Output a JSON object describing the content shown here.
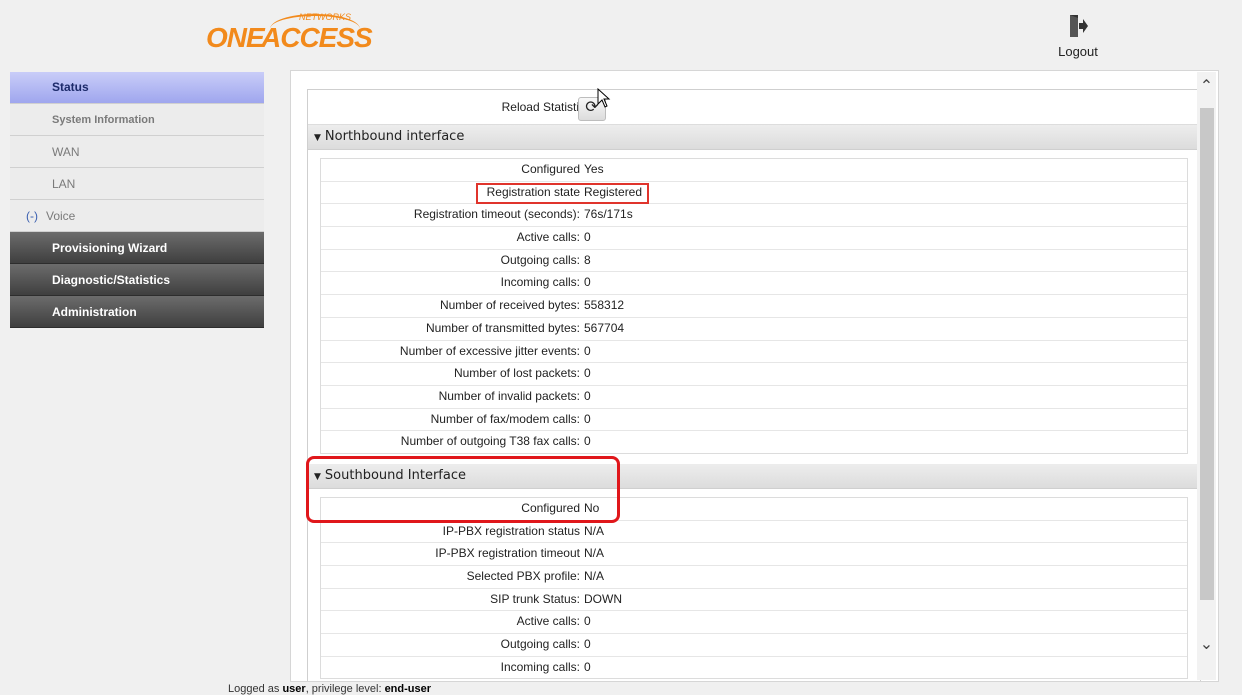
{
  "brand": {
    "one": "ONE",
    "access": "ACCESS",
    "networks": "NETWORKS"
  },
  "header": {
    "logout_label": "Logout",
    "logout_icon": "logout-door-icon"
  },
  "sidebar": {
    "items": [
      {
        "label": "Status"
      },
      {
        "label": "System Information"
      },
      {
        "label": "WAN"
      },
      {
        "label": "LAN"
      },
      {
        "label": "Voice",
        "toggle": "(-)"
      },
      {
        "label": "Provisioning Wizard"
      },
      {
        "label": "Diagnostic/Statistics"
      },
      {
        "label": "Administration"
      }
    ]
  },
  "main": {
    "reload_label": "Reload Statistics",
    "reload_icon": "refresh-icon",
    "northbound": {
      "title": "Northbound interface",
      "rows": [
        {
          "k": "Configured",
          "v": "Yes"
        },
        {
          "k": "Registration state",
          "v": "Registered"
        },
        {
          "k": "Registration timeout (seconds):",
          "v": "76s/171s"
        },
        {
          "k": "Active calls:",
          "v": "0"
        },
        {
          "k": "Outgoing calls:",
          "v": "8"
        },
        {
          "k": "Incoming calls:",
          "v": "0"
        },
        {
          "k": "Number of received bytes:",
          "v": "558312"
        },
        {
          "k": "Number of transmitted bytes:",
          "v": "567704"
        },
        {
          "k": "Number of excessive jitter events:",
          "v": "0"
        },
        {
          "k": "Number of lost packets:",
          "v": "0"
        },
        {
          "k": "Number of invalid packets:",
          "v": "0"
        },
        {
          "k": "Number of fax/modem calls:",
          "v": "0"
        },
        {
          "k": "Number of outgoing T38 fax calls:",
          "v": "0"
        }
      ]
    },
    "southbound": {
      "title": "Southbound Interface",
      "rows": [
        {
          "k": "Configured",
          "v": "No"
        },
        {
          "k": "IP-PBX registration status",
          "v": "N/A"
        },
        {
          "k": "IP-PBX registration timeout",
          "v": "N/A"
        },
        {
          "k": "Selected PBX profile:",
          "v": "N/A"
        },
        {
          "k": "SIP trunk Status:",
          "v": "DOWN"
        },
        {
          "k": "Active calls:",
          "v": "0"
        },
        {
          "k": "Outgoing calls:",
          "v": "0"
        },
        {
          "k": "Incoming calls:",
          "v": "0"
        }
      ]
    }
  },
  "footer": {
    "prefix": "Logged as ",
    "user": "user",
    "middle": ", privilege level: ",
    "level": "end-user"
  },
  "colors": {
    "accent_orange": "#f28a1c",
    "highlight_red": "#e0171b",
    "active_nav": "#a9b0f0",
    "dark_nav": "#4a4a4a"
  }
}
